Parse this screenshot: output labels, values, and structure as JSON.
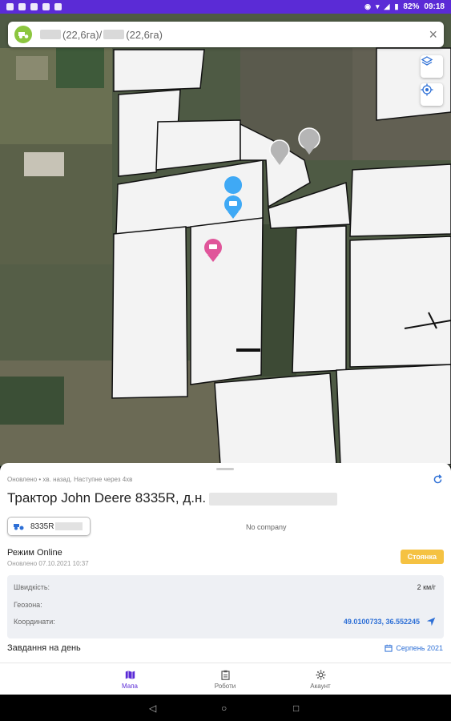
{
  "status_bar": {
    "battery": "82%",
    "time": "09:18"
  },
  "field_bar": {
    "area_a": "(22,6га)/",
    "area_b": "(22,6га)",
    "close_label": "×"
  },
  "vehicle": {
    "updated_line": "Оновлено • хв. назад. Наступне через 4хв",
    "title": "Трактор John Deere 8335R, д.н.",
    "chip_label": "8335R",
    "company": "No company"
  },
  "mode": {
    "label": "Режим Online",
    "updated": "Оновлено 07.10.2021 10:37",
    "badge": "Стоянка"
  },
  "info": {
    "speed_label": "Швидкість:",
    "speed_value": "2 км/г",
    "geozone_label": "Геозона:",
    "coords_label": "Координати:",
    "coords_value": "49.0100733, 36.552245"
  },
  "tasks": {
    "label": "Завдання на день",
    "date": "Серпень 2021"
  },
  "nav": {
    "items": [
      {
        "label": "Мапа"
      },
      {
        "label": "Роботи"
      },
      {
        "label": "Акаунт"
      }
    ]
  },
  "colors": {
    "accent": "#5b2bd6",
    "link": "#2d6fd6",
    "badge": "#f5c242",
    "marker_blue": "#3fa9f5",
    "marker_pink": "#e0559a",
    "marker_grey": "#b5b5b5"
  }
}
